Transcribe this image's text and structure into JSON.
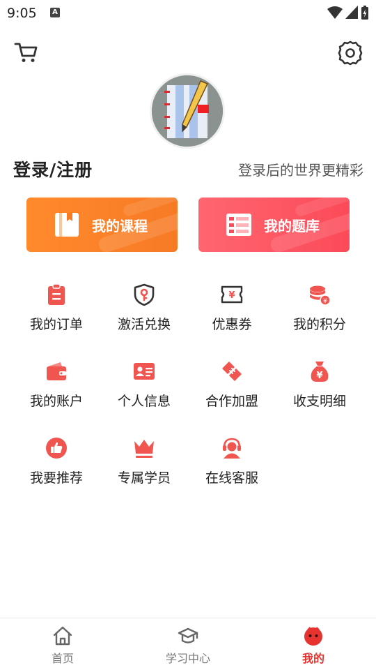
{
  "status_bar": {
    "time": "9:05",
    "indicator": "A"
  },
  "header": {
    "cart_icon": "cart-icon",
    "settings_icon": "gear-icon"
  },
  "profile": {
    "avatar_icon": "notebook-pencil-avatar",
    "login_label": "登录/注册",
    "login_subtitle": "登录后的世界更精彩"
  },
  "big_buttons": [
    {
      "label": "我的课程",
      "icon": "book-icon",
      "color": "#f9802a"
    },
    {
      "label": "我的题库",
      "icon": "question-bank-icon",
      "color": "#fd5661"
    }
  ],
  "menu": [
    {
      "label": "我的订单",
      "icon": "order-clipboard-icon"
    },
    {
      "label": "激活兑换",
      "icon": "shield-key-icon"
    },
    {
      "label": "优惠券",
      "icon": "coupon-icon"
    },
    {
      "label": "我的积分",
      "icon": "coins-icon"
    },
    {
      "label": "我的账户",
      "icon": "wallet-icon"
    },
    {
      "label": "个人信息",
      "icon": "id-card-icon"
    },
    {
      "label": "合作加盟",
      "icon": "handshake-icon"
    },
    {
      "label": "收支明细",
      "icon": "money-bag-icon"
    },
    {
      "label": "我要推荐",
      "icon": "thumbs-up-icon"
    },
    {
      "label": "专属学员",
      "icon": "crown-icon"
    },
    {
      "label": "在线客服",
      "icon": "customer-service-icon"
    }
  ],
  "bottom_nav": [
    {
      "label": "首页",
      "icon": "home-icon",
      "active": false
    },
    {
      "label": "学习中心",
      "icon": "graduation-cap-icon",
      "active": false
    },
    {
      "label": "我的",
      "icon": "mascot-face-icon",
      "active": true
    }
  ],
  "colors": {
    "accent": "#e7332f",
    "icon_red": "#f0554f"
  }
}
